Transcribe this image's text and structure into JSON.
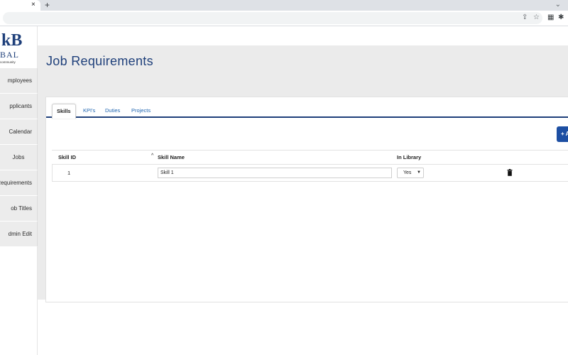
{
  "browser": {
    "tab_close": "×",
    "new_tab": "+",
    "tab_dropdown": "⌄"
  },
  "logo": {
    "line1": "kB",
    "line2": "BAL",
    "line3": "community"
  },
  "sidebar": {
    "items": [
      {
        "label": "mployees"
      },
      {
        "label": "pplicants"
      },
      {
        "label": "Calendar"
      },
      {
        "label": "Jobs"
      },
      {
        "label": "Requirements"
      },
      {
        "label": "ob Titles"
      },
      {
        "label": "dmin Edit"
      }
    ]
  },
  "page": {
    "title": "Job Requirements"
  },
  "tabs": [
    {
      "label": "Skills",
      "active": true
    },
    {
      "label": "KPI's",
      "active": false
    },
    {
      "label": "Duties",
      "active": false
    },
    {
      "label": "Projects",
      "active": false
    }
  ],
  "add_button": {
    "label": "+ A"
  },
  "table": {
    "headers": {
      "skill_id": "Skill ID",
      "sort_indicator": "^",
      "skill_name": "Skill Name",
      "in_library": "In Library"
    },
    "rows": [
      {
        "skill_id": "1",
        "skill_name": "Skill 1",
        "in_library": "Yes"
      }
    ]
  },
  "colors": {
    "accent": "#1e3f7a",
    "button": "#1d4fa3",
    "link": "#1e64b0"
  },
  "icons": [
    "close-icon",
    "plus-icon",
    "chevron-down-icon",
    "share-icon",
    "star-icon",
    "extension-icon",
    "puzzle-icon",
    "sort-up-icon",
    "trash-icon"
  ]
}
